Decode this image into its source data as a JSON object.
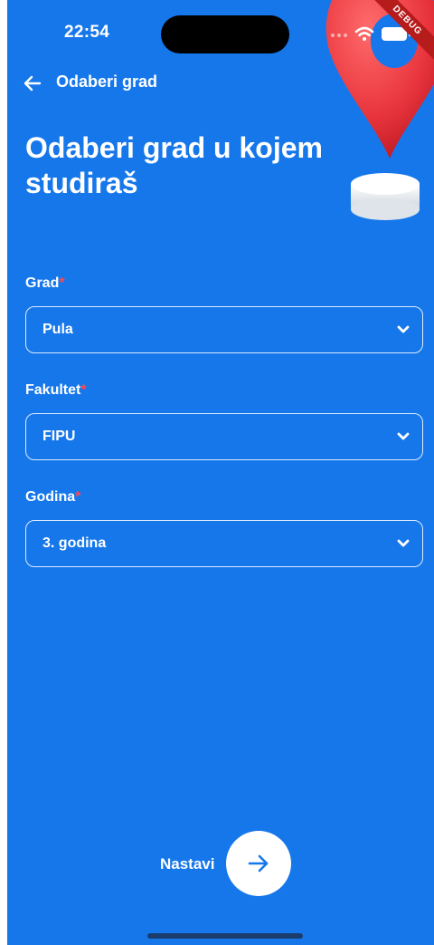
{
  "status_bar": {
    "time": "22:54",
    "debug_label": "DEBUG",
    "icons": [
      "wifi-icon",
      "battery-icon"
    ]
  },
  "app_bar": {
    "title": "Odaberi grad"
  },
  "heading": "Odaberi grad u kojem studiraš",
  "form": {
    "city": {
      "label": "Grad",
      "required_mark": "*",
      "value": "Pula"
    },
    "faculty": {
      "label": "Fakultet",
      "required_mark": "*",
      "value": "FIPU"
    },
    "year": {
      "label": "Godina",
      "required_mark": "*",
      "value": "3. godina"
    }
  },
  "footer": {
    "continue_label": "Nastavi"
  },
  "colors": {
    "background": "#1677eb",
    "required": "#ff4a4a",
    "pin": "#e8343c"
  }
}
